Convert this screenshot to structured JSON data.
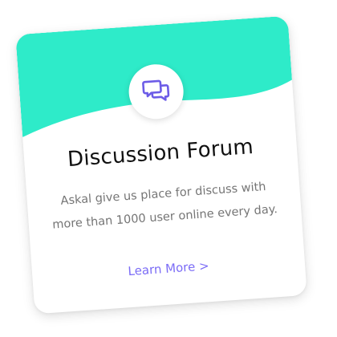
{
  "card": {
    "title": "Discussion Forum",
    "description": "Askal give us place for discuss with more than 1000 user online every day.",
    "link_label": "Learn More >",
    "icon": "chat-bubbles-icon"
  },
  "colors": {
    "header": "#2eebc9",
    "icon": "#6c5ce7",
    "link": "#7b6cf6",
    "title": "#111111",
    "description": "#757575"
  }
}
